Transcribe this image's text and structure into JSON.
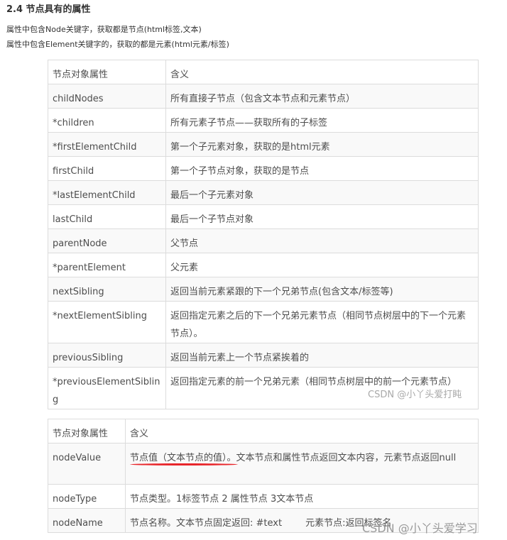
{
  "heading": "2.4 节点具有的属性",
  "notes": [
    "属性中包含Node关键字，获取都是节点(html标签,文本)",
    "属性中包含Element关键字的，获取的都是元素(html元素/标签)"
  ],
  "table1": {
    "headers": [
      "节点对象属性",
      "含义"
    ],
    "rows": [
      [
        "childNodes",
        "所有直接子节点（包含文本节点和元素节点）"
      ],
      [
        "*children",
        "所有元素子节点——获取所有的子标签"
      ],
      [
        "*firstElementChild",
        "第一个子元素对象，获取的是html元素"
      ],
      [
        "firstChild",
        "第一个子节点对象，获取的是节点"
      ],
      [
        "*lastElementChild",
        "最后一个子元素对象"
      ],
      [
        "lastChild",
        "最后一个子节点对象"
      ],
      [
        "parentNode",
        "父节点"
      ],
      [
        "*parentElement",
        "父元素"
      ],
      [
        "nextSibling",
        "返回当前元素紧跟的下一个兄弟节点(包含文本/标签等)"
      ],
      [
        "*nextElementSibling",
        "返回指定元素之后的下一个兄弟元素节点（相同节点树层中的下一个元素节点）。"
      ],
      [
        "previousSibling",
        "返回当前元素上一个节点紧挨着的"
      ],
      [
        "*previousElementSibling",
        "返回指定元素的前一个兄弟元素（相同节点树层中的前一个元素节点）"
      ]
    ]
  },
  "table2": {
    "headers": [
      "节点对象属性",
      "含义"
    ],
    "rows": [
      [
        "nodeValue",
        "节点值（文本节点的值）。文本节点和属性节点返回文本内容，元素节点返回null"
      ],
      [
        "nodeType",
        "节点类型。1标签节点 2 属性节点 3文本节点"
      ],
      [
        "nodeName",
        "节点名称。文本节点固定返回: #text        元素节点:返回标签名"
      ]
    ]
  },
  "watermarks": [
    "CSDN @小丫头爱打盹",
    "CSDN @小丫头爱学习"
  ],
  "colors": {
    "annotation": "#e8262b"
  }
}
